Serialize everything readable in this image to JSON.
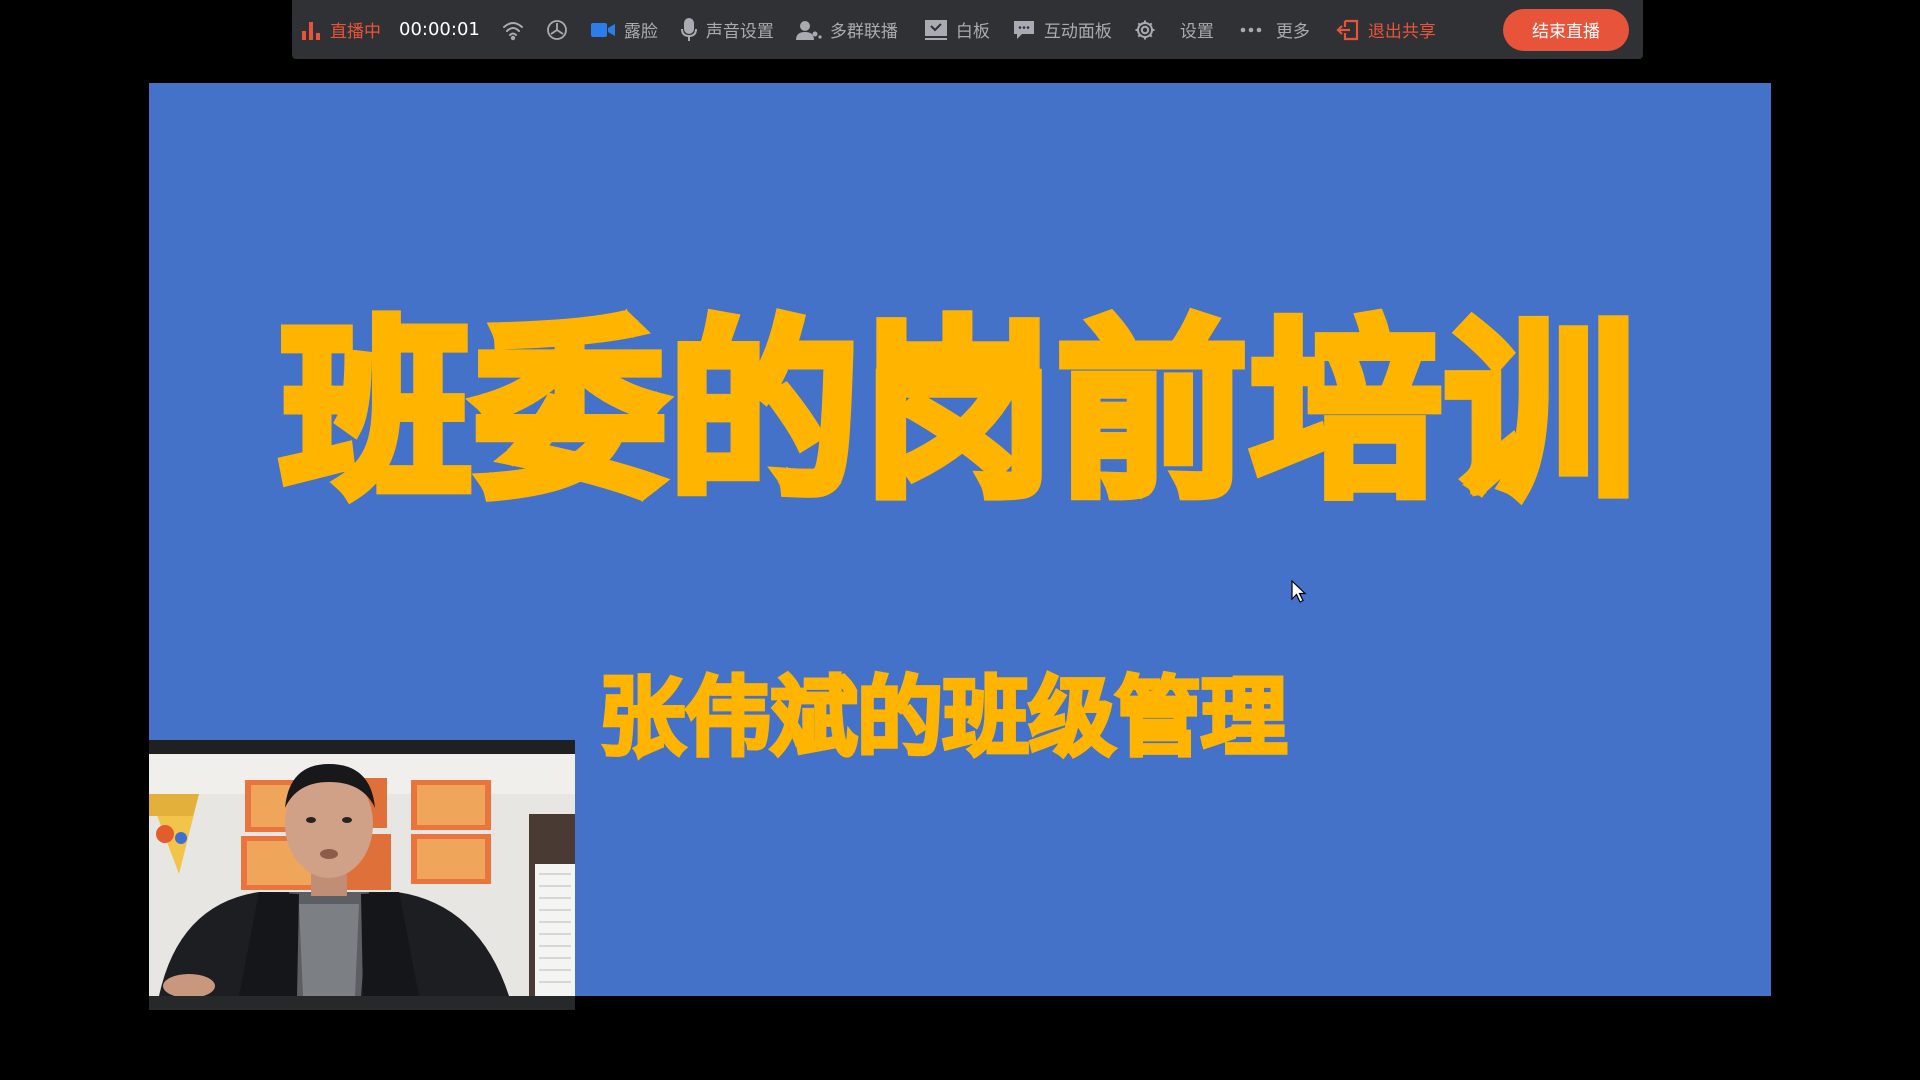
{
  "toolbar": {
    "live_status": "直播中",
    "timer": "00:00:01",
    "beauty": "露脸",
    "sound_settings": "声音设置",
    "multi_group": "多群联播",
    "whiteboard": "白板",
    "interactive_panel": "互动面板",
    "settings": "设置",
    "more": "更多",
    "exit_share": "退出共享",
    "end_live": "结束直播"
  },
  "slide": {
    "title": "班委的岗前培训",
    "subtitle": "张伟斌的班级管理"
  },
  "icons": {
    "live": "bar-chart-icon",
    "network": "wifi-icon",
    "cpu": "gauge-icon",
    "camera": "video-camera-icon",
    "mic": "microphone-icon",
    "multi_group": "users-icon",
    "whiteboard": "whiteboard-icon",
    "interactive_panel": "chat-icon",
    "settings": "gear-icon",
    "more": "ellipsis-icon",
    "exit_share": "exit-icon"
  },
  "colors": {
    "toolbar_bg": "#2f3134",
    "accent_red": "#e8543a",
    "camera_blue": "#2b7de9",
    "slide_bg": "#4472c9",
    "slide_text": "#ffb400"
  }
}
